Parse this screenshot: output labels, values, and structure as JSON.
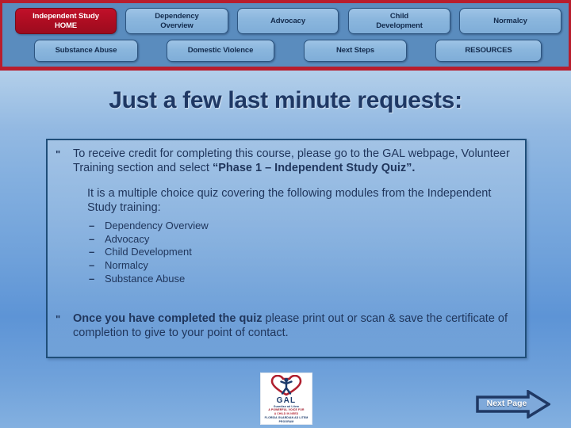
{
  "nav": {
    "buttons": [
      {
        "id": "home",
        "label": "Independent Study\nHOME",
        "active": true
      },
      {
        "id": "dependency",
        "label": "Dependency\nOverview",
        "active": false
      },
      {
        "id": "advocacy",
        "label": "Advocacy",
        "active": false
      },
      {
        "id": "child",
        "label": "Child\nDevelopment",
        "active": false
      },
      {
        "id": "normalcy",
        "label": "Normalcy",
        "active": false
      },
      {
        "id": "substance",
        "label": "Substance Abuse",
        "active": false
      },
      {
        "id": "domestic",
        "label": "Domestic Violence",
        "active": false
      },
      {
        "id": "nextsteps",
        "label": "Next Steps",
        "active": false
      },
      {
        "id": "resources",
        "label": "RESOURCES",
        "active": false
      }
    ],
    "accent_color": "#b81d2d",
    "bar_color": "#5a8cbe",
    "active_color": "#b30f26"
  },
  "slide": {
    "title": "Just a few last minute requests:",
    "title_color": "#1f3864",
    "bullet_glyph": "\""
  },
  "content": {
    "paragraph_1": {
      "plain_a": "To receive credit for completing this course, please go to the GAL webpage, Volunteer Training section and select ",
      "bold_b": "“Phase 1 – Independent Study Quiz”."
    },
    "paragraph_sub": "It is a multiple choice quiz covering the following modules from the Independent Study training:",
    "module_dash": "–",
    "modules": [
      "Dependency Overview",
      "Advocacy",
      "Child Development",
      "Normalcy",
      "Substance Abuse"
    ],
    "paragraph_2": {
      "bold_a": "Once you have completed the quiz",
      "plain_b": " please print out or scan & save the certificate of completion to give to your point of contact."
    },
    "box_border_color": "#1f4e79"
  },
  "logo": {
    "word": "GAL",
    "line1": "Guardian ad Litem",
    "line2": "A POWERFUL VOICE FOR",
    "line3": "A CHILD IN NEED",
    "line4": "FLORIDA GUARDIAN AD LITEM",
    "line5": "PROGRAM"
  },
  "footer": {
    "next_page_label": "Next Page",
    "next_page_fill": "#7fa9da",
    "next_page_stroke": "#1f3864"
  }
}
